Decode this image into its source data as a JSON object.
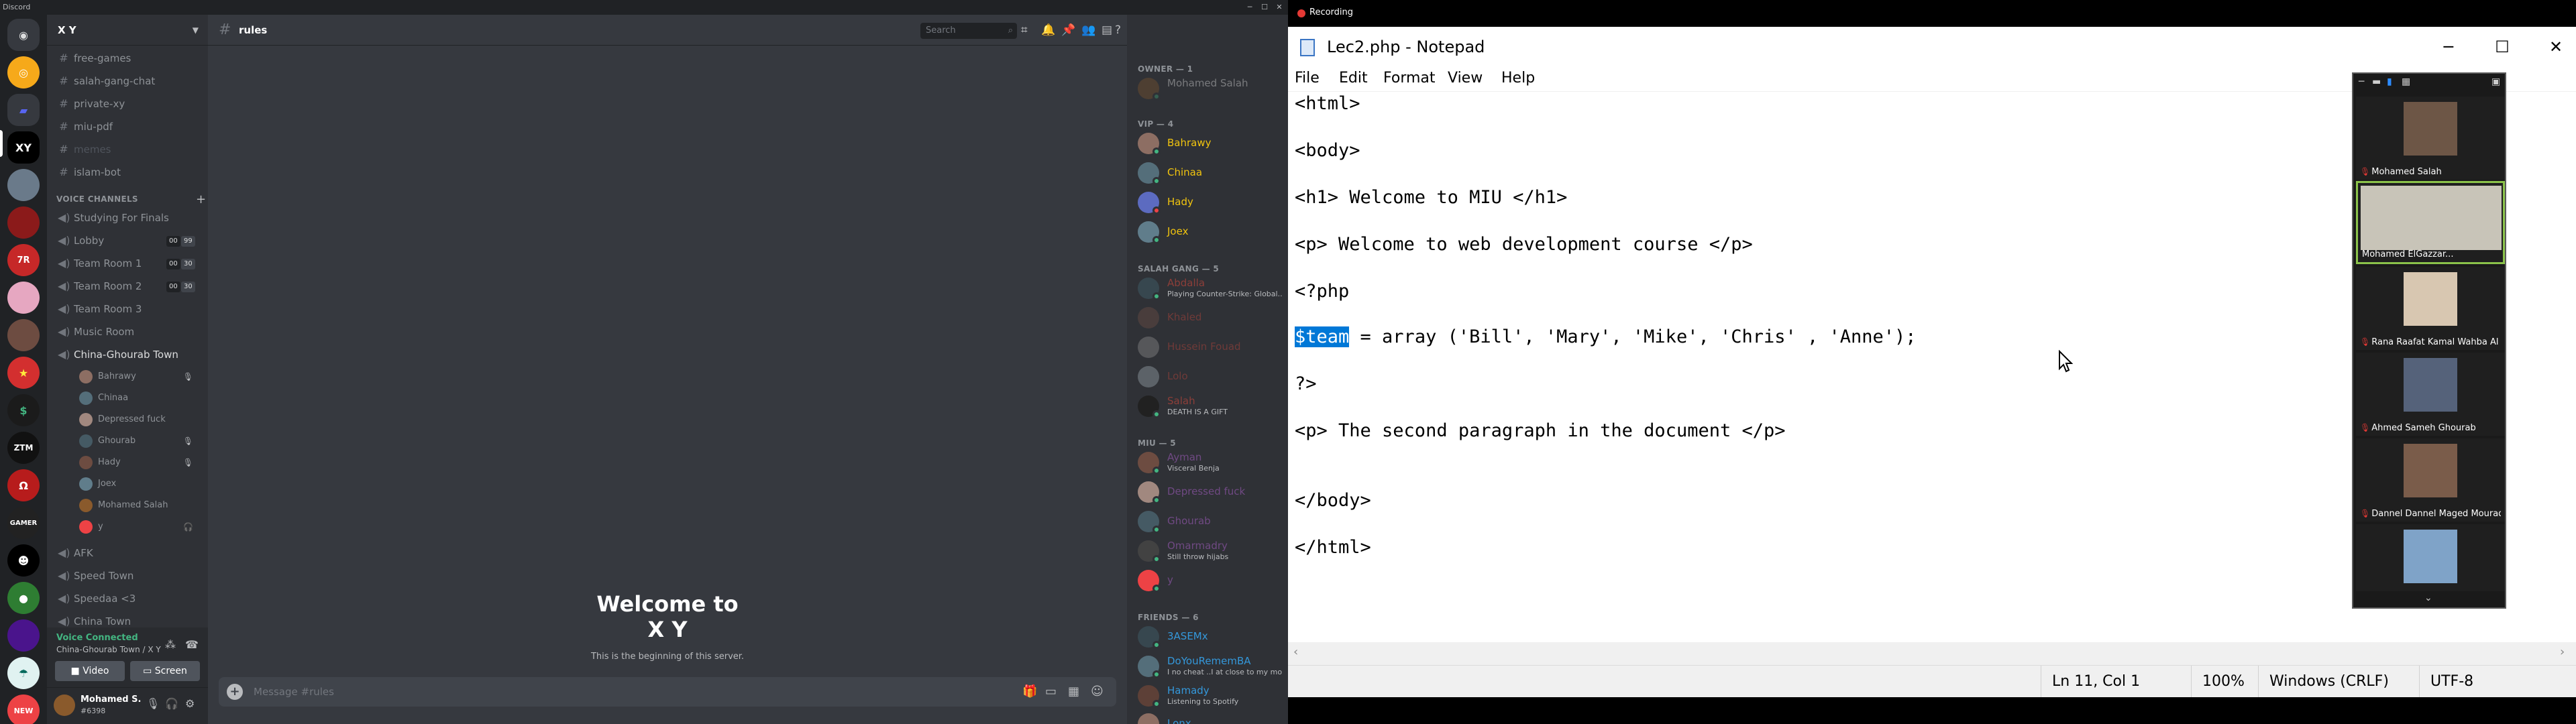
{
  "discord": {
    "app_name": "Discord",
    "server_name": "X Y",
    "channels_top": [
      "free-games",
      "salah-gang-chat",
      "private-xy",
      "miu-pdf",
      "memes",
      "islam-bot"
    ],
    "voice_category": "VOICE CHANNELS",
    "voice_channels": [
      {
        "name": "Studying For Finals",
        "badge": ""
      },
      {
        "name": "Lobby",
        "badge": "00",
        "badge2": "99"
      },
      {
        "name": "Team Room 1",
        "badge": "00",
        "badge2": "30"
      },
      {
        "name": "Team Room 2",
        "badge": "00",
        "badge2": "30"
      },
      {
        "name": "Team Room 3",
        "badge": ""
      },
      {
        "name": "Music Room",
        "badge": ""
      },
      {
        "name": "China-Ghourab Town",
        "badge": ""
      }
    ],
    "voice_users": [
      "Bahrawy",
      "Chinaa",
      "Depressed fuck",
      "Ghourab",
      "Hady",
      "Joex",
      "Mohamed Salah",
      "y"
    ],
    "voice_channels_after": [
      "AFK",
      "Speed Town",
      "Speedaa <3",
      "China Town"
    ],
    "voice_status": "Voice Connected",
    "voice_location": "China-Ghourab Town / X Y",
    "video_label": "Video",
    "screen_label": "Screen",
    "user_name": "Mohamed S...",
    "user_tag": "#6398",
    "new_badge": "NEW",
    "current_channel": "rules",
    "search_placeholder": "Search",
    "welcome_line1": "Welcome to",
    "welcome_line2": "X Y",
    "welcome_sub": "This is the beginning of this server.",
    "message_placeholder": "Message #rules",
    "members": {
      "owner_header": "OWNER — 1",
      "owner": [
        {
          "name": "Mohamed Salah",
          "color": "#ffffff",
          "sub": ""
        }
      ],
      "vip_header": "VIP — 4",
      "vip": [
        {
          "name": "Bahrawy",
          "color": "#f1c40f",
          "sub": ""
        },
        {
          "name": "Chinaa",
          "color": "#f1c40f",
          "sub": ""
        },
        {
          "name": "Hady",
          "color": "#f1c40f",
          "sub": ""
        },
        {
          "name": "Joex",
          "color": "#f1c40f",
          "sub": ""
        }
      ],
      "salah_header": "SALAH GANG — 5",
      "salah": [
        {
          "name": "Abdalla",
          "color": "#e74c3c",
          "sub": "Playing Counter-Strike: Global..."
        },
        {
          "name": "Khaled",
          "color": "#e74c3c",
          "sub": ""
        },
        {
          "name": "Hussein Fouad",
          "color": "#e74c3c",
          "sub": ""
        },
        {
          "name": "Lolo",
          "color": "#e74c3c",
          "sub": ""
        },
        {
          "name": "Salah",
          "color": "#e74c3c",
          "sub": "DEATH IS A GIFT"
        }
      ],
      "miu_header": "MIU — 5",
      "miu": [
        {
          "name": "Ayman",
          "color": "#9b59b6",
          "sub": "Visceral Benja"
        },
        {
          "name": "Depressed fuck",
          "color": "#9b59b6",
          "sub": ""
        },
        {
          "name": "Ghourab",
          "color": "#9b59b6",
          "sub": ""
        },
        {
          "name": "Omarmadry",
          "color": "#9b59b6",
          "sub": "Still throw hijabs"
        },
        {
          "name": "y",
          "color": "#9b59b6",
          "sub": ""
        }
      ],
      "friends_header": "FRIENDS — 6",
      "friends": [
        {
          "name": "3ASEMx",
          "color": "#3498db",
          "sub": ""
        },
        {
          "name": "DoYouRememBA",
          "color": "#3498db",
          "sub": "I no cheat ..I at close to my mo..."
        },
        {
          "name": "Hamady",
          "color": "#3498db",
          "sub": "Listening to Spotify"
        },
        {
          "name": "Lonx",
          "color": "#3498db",
          "sub": ""
        }
      ]
    }
  },
  "notepad": {
    "recording_label": "Recording",
    "title": "Lec2.php - Notepad",
    "menu": [
      "File",
      "Edit",
      "Format",
      "View",
      "Help"
    ],
    "lines": [
      {
        "text": "<html>"
      },
      {
        "text": "<body>"
      },
      {
        "text": "<h1> Welcome to MIU </h1>"
      },
      {
        "text": "<p> Welcome to web development course </p>"
      },
      {
        "text": "<?php"
      },
      {
        "text": " = array ('Bill', 'Mary', 'Mike', 'Chris' , 'Anne');",
        "selected": "$team"
      },
      {
        "text": "?>"
      },
      {
        "text": "<p> The second paragraph in the document </p>"
      },
      {
        "text": "</body>"
      },
      {
        "text": "</html>"
      }
    ],
    "status": {
      "position": "Ln 11, Col 1",
      "zoom": "100%",
      "line_ending": "Windows (CRLF)",
      "encoding": "UTF-8"
    }
  },
  "zoom_gallery": {
    "participants": [
      "Mohamed Salah",
      "Mohamed ElGazzar...",
      "Rana Raafat Kamal Wahba Al Att...",
      "Ahmed Sameh Ghourab",
      "Dannel Dannel Maged Mourad ...",
      ""
    ]
  },
  "colors": {
    "discord_bg": "#36393f",
    "discord_sidebar": "#2f3136",
    "voice_connected": "#43b581",
    "selection": "#0078d7"
  }
}
